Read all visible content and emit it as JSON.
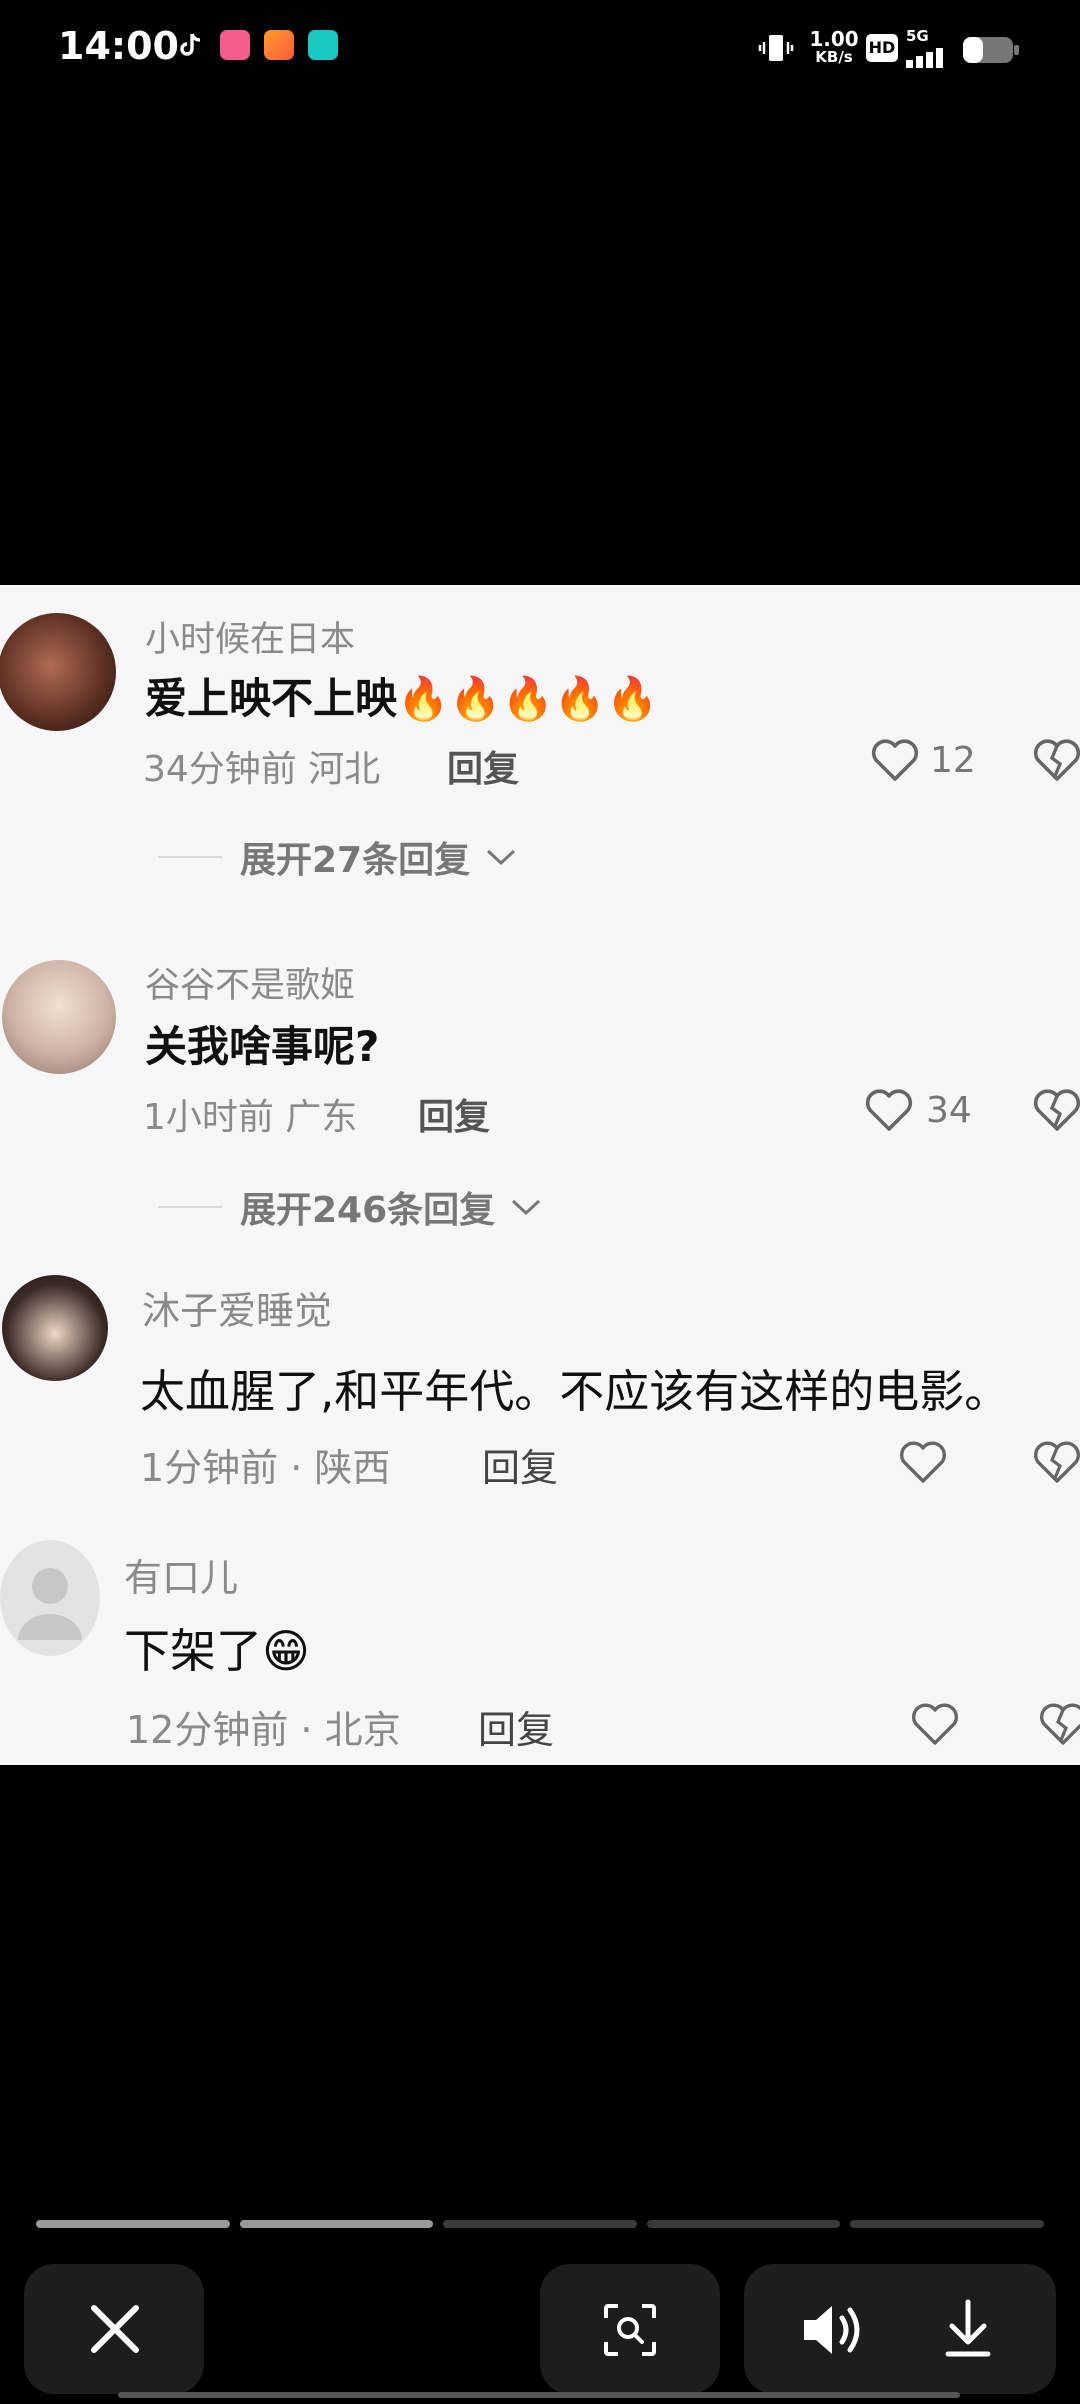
{
  "status_bar": {
    "time": "14:00",
    "net_speed_value": "1.00",
    "net_speed_unit": "KB/s",
    "hd_label": "HD",
    "network_label": "5G"
  },
  "comments": [
    {
      "username": "小时候在日本",
      "text": "爱上映不上映",
      "emoji": "🔥🔥🔥🔥🔥",
      "time_location": "34分钟前 河北",
      "reply_label": "回复",
      "like_count": "12",
      "expand_label": "展开27条回复"
    },
    {
      "username": "谷谷不是歌姬",
      "text": "关我啥事呢?",
      "time_location": "1小时前 广东",
      "reply_label": "回复",
      "like_count": "34",
      "expand_label": "展开246条回复"
    },
    {
      "username": "沐子爱睡觉",
      "text": "太血腥了,和平年代。不应该有这样的电影。",
      "time_location": "1分钟前 · 陕西",
      "reply_label": "回复"
    },
    {
      "username": "有口儿",
      "text": "下架了",
      "emoji": "😁",
      "time_location": "12分钟前 · 北京",
      "reply_label": "回复"
    }
  ],
  "viewer": {
    "progress_total": 5,
    "progress_active": 2
  },
  "icons": {
    "close": "close-icon",
    "scan": "image-search-icon",
    "sound": "speaker-icon",
    "download": "download-icon"
  }
}
